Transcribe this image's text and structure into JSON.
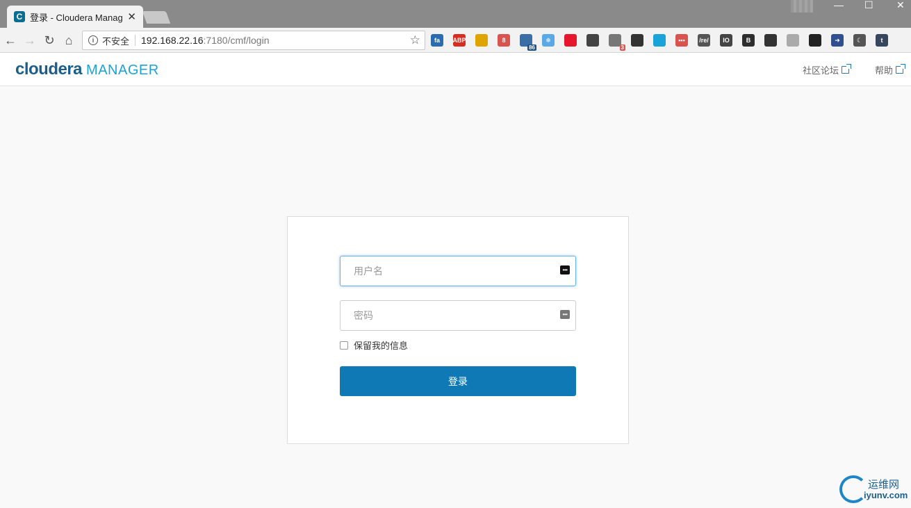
{
  "browser": {
    "tab": {
      "favicon": "C",
      "title": "登录 - Cloudera Manag",
      "close_glyph": "✕"
    },
    "window_controls": {
      "minimize": "—",
      "maximize": "☐",
      "close": "✕"
    },
    "nav": {
      "back": "←",
      "forward": "→",
      "reload": "↻",
      "home": "⌂"
    },
    "omnibox": {
      "security_label": "不安全",
      "url_host": "192.168.22.16",
      "url_path": ":7180/cmf/login",
      "star": "☆"
    },
    "extensions": [
      {
        "name": "fa-icon",
        "label": "fa",
        "color": "#2b6cb0"
      },
      {
        "name": "adblock-icon",
        "label": "ABP",
        "color": "#d62d20"
      },
      {
        "name": "ring-icon",
        "label": "",
        "color": "#e0a400"
      },
      {
        "name": "red-square-icon",
        "label": "8",
        "color": "#d9534f"
      },
      {
        "name": "mail-icon",
        "label": "",
        "color": "#3a6ea5",
        "badge": "86"
      },
      {
        "name": "snowflake-icon",
        "label": "❄",
        "color": "#5aa9e6"
      },
      {
        "name": "weibo-icon",
        "label": "",
        "color": "#e6162d"
      },
      {
        "name": "clock-icon",
        "label": "",
        "color": "#444444"
      },
      {
        "name": "bell-icon",
        "label": "",
        "color": "#777777",
        "badge": "3",
        "badge_red": true
      },
      {
        "name": "zh-en-icon",
        "label": "",
        "color": "#333333"
      },
      {
        "name": "search-ext-icon",
        "label": "",
        "color": "#1aa3d9"
      },
      {
        "name": "dots-ext-icon",
        "label": "•••",
        "color": "#d9534f"
      },
      {
        "name": "regex-icon",
        "label": "/re/",
        "color": "#555555"
      },
      {
        "name": "io-icon",
        "label": "IO",
        "color": "#444444"
      },
      {
        "name": "bold-b-icon",
        "label": "B",
        "color": "#2d2d2d"
      },
      {
        "name": "evernote-icon",
        "label": "",
        "color": "#333333"
      },
      {
        "name": "angular-icon",
        "label": "",
        "color": "#aaaaaa"
      },
      {
        "name": "tampermonkey-icon",
        "label": "",
        "color": "#222222"
      },
      {
        "name": "arrow-ext-icon",
        "label": "➜",
        "color": "#2f4f8f"
      },
      {
        "name": "moon-icon",
        "label": "☾",
        "color": "#555555"
      },
      {
        "name": "tumblr-icon",
        "label": "t",
        "color": "#36465d"
      }
    ]
  },
  "header": {
    "logo_primary": "cloudera",
    "logo_secondary": "MANAGER",
    "links": [
      {
        "label": "社区论坛"
      },
      {
        "label": "帮助"
      }
    ]
  },
  "login": {
    "username_placeholder": "用户名",
    "password_placeholder": "密码",
    "remember_label": "保留我的信息",
    "submit_label": "登录"
  },
  "watermark": {
    "cn": "运维网",
    "en": "iyunv.com"
  },
  "colors": {
    "brand_primary": "#1a5f8c",
    "brand_secondary": "#1aa3d9",
    "button": "#0f79b5",
    "focus": "#66afe9"
  }
}
